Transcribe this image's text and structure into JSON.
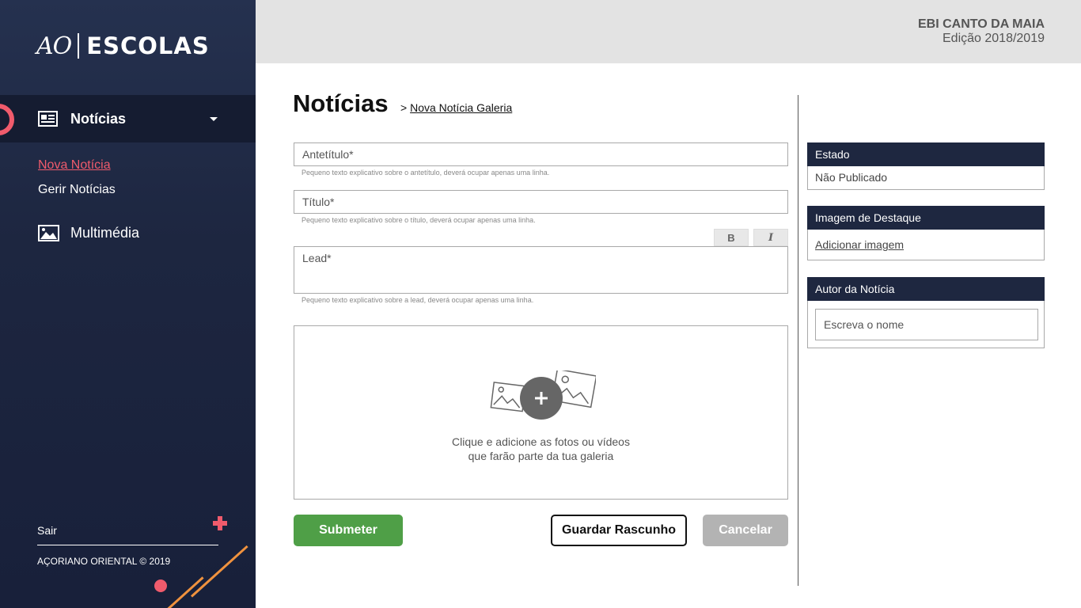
{
  "brand": {
    "logo_left": "AO",
    "logo_right": "ESCOLAS"
  },
  "sidebar": {
    "active_section": "Notícias",
    "sub_items": [
      "Nova Notícia",
      "Gerir Notícias"
    ],
    "section2": "Multimédia",
    "logout": "Sair",
    "copyright": "AÇORIANO ORIENTAL © 2019"
  },
  "header": {
    "school": "EBI CANTO DA MAIA",
    "edition": "Edição 2018/2019"
  },
  "main": {
    "title": "Notícias",
    "breadcrumb_sep": ">",
    "breadcrumb_link": "Nova Notícia Galeria",
    "antetitulo_placeholder": "Antetítulo*",
    "antetitulo_help": "Pequeno texto explicativo sobre o antetítulo, deverá ocupar apenas uma linha.",
    "titulo_placeholder": "Título*",
    "titulo_help": "Pequeno texto explicativo sobre o título, deverá ocupar apenas uma linha.",
    "bold_label": "B",
    "italic_label": "I",
    "lead_placeholder": "Lead*",
    "lead_help": "Pequeno texto explicativo sobre a lead, deverá ocupar apenas uma linha.",
    "dropzone_line1": "Clique e adicione as fotos ou vídeos",
    "dropzone_line2": "que farão parte da tua galeria",
    "submit": "Submeter",
    "draft": "Guardar Rascunho",
    "cancel": "Cancelar"
  },
  "side_panels": {
    "estado_title": "Estado",
    "estado_value": "Não Publicado",
    "imagem_title": "Imagem de Destaque",
    "imagem_link": "Adicionar imagem",
    "autor_title": "Autor da Notícia",
    "autor_placeholder": "Escreva o nome"
  },
  "colors": {
    "accent": "#f05b6c",
    "sidebar": "#1d2640",
    "submit": "#4f9f47",
    "deco": "#f0923e"
  }
}
